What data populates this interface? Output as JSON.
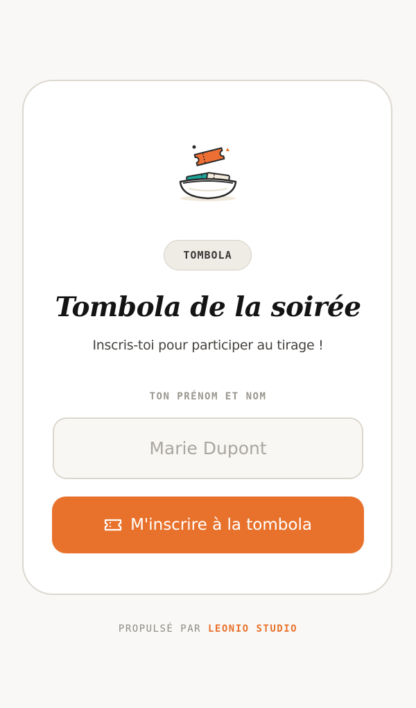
{
  "badge": {
    "label": "TOMBOLA"
  },
  "title": "Tombola de la soirée",
  "subtitle": "Inscris-toi pour participer au tirage !",
  "form": {
    "name_label": "TON PRÉNOM ET NOM",
    "name_value": "",
    "name_placeholder": "Marie Dupont",
    "submit_label": "M'inscrire à la tombola",
    "submit_icon": "ticket-icon"
  },
  "footer": {
    "prefix": "PROPULSÉ PAR",
    "brand": "LEONIO STUDIO"
  },
  "illustration": {
    "icon": "ticket-bowl-icon"
  },
  "colors": {
    "accent": "#e8722c",
    "teal": "#1aa59a",
    "background": "#f9f8f6",
    "card": "#ffffff",
    "title": "#141414"
  }
}
